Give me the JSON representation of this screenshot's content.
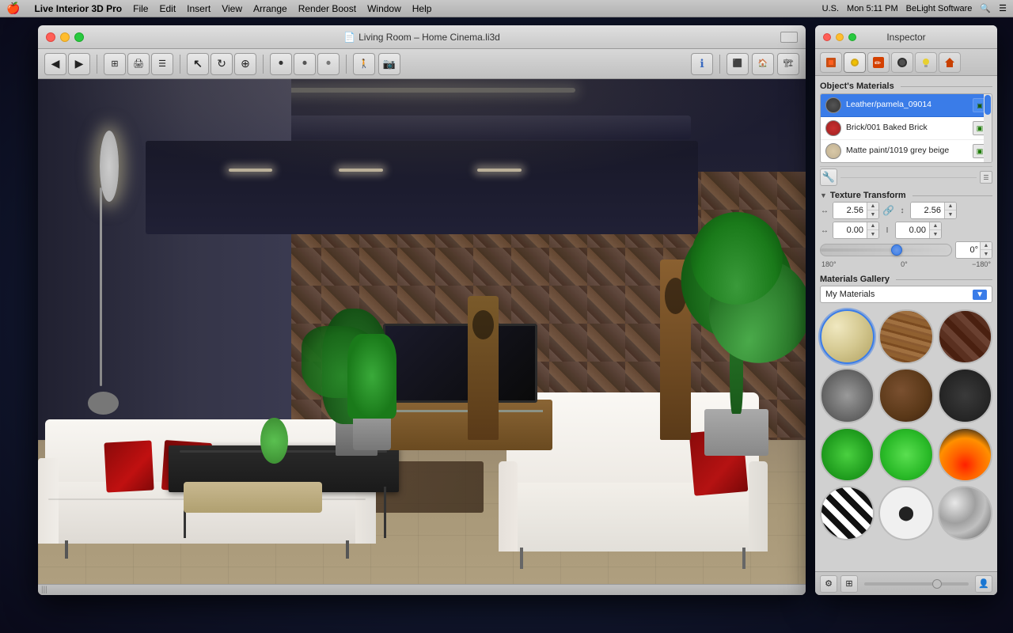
{
  "menubar": {
    "apple": "🍎",
    "app_name": "Live Interior 3D Pro",
    "menus": [
      "File",
      "Edit",
      "Insert",
      "View",
      "Arrange",
      "Render Boost",
      "Window",
      "Help"
    ],
    "right": {
      "time": "Mon 5:11 PM",
      "company": "BeLight Software",
      "battery": "U.S.",
      "search_icon": "🔍"
    }
  },
  "main_window": {
    "title": "Living Room – Home Cinema.li3d",
    "title_icon": "📄"
  },
  "inspector": {
    "title": "Inspector",
    "tabs": [
      {
        "id": "materials-tab",
        "icon": "🟧",
        "active": false
      },
      {
        "id": "light-tab",
        "icon": "⚪",
        "active": true
      },
      {
        "id": "paint-tab",
        "icon": "✏️",
        "active": false
      },
      {
        "id": "texture-tab",
        "icon": "⬛",
        "active": false
      },
      {
        "id": "bulb-tab",
        "icon": "💡",
        "active": false
      },
      {
        "id": "house-tab",
        "icon": "🏠",
        "active": false
      }
    ],
    "objects_materials_label": "Object's Materials",
    "materials": [
      {
        "id": "mat-leather",
        "name": "Leather/pamela_09014",
        "color": "#4a4a4a",
        "selected": true,
        "has_icon": true
      },
      {
        "id": "mat-brick",
        "name": "Brick/001 Baked Brick",
        "color": "#c03030",
        "selected": false,
        "has_icon": true
      },
      {
        "id": "mat-paint",
        "name": "Matte paint/1019 grey beige",
        "color": "#d4c8a8",
        "selected": false,
        "has_icon": true
      }
    ],
    "texture_transform": {
      "label": "Texture Transform",
      "width_value": "2.56",
      "height_value": "2.56",
      "offset_x": "0.00",
      "offset_y": "0.00",
      "rotation_value": "0°",
      "rotation_min": "180°",
      "rotation_center": "0°",
      "rotation_max": "−180°"
    },
    "gallery": {
      "label": "Materials Gallery",
      "dropdown_value": "My Materials",
      "items": [
        {
          "id": "g-fabric",
          "type": "fabric",
          "selected": true
        },
        {
          "id": "g-wood1",
          "type": "wood1",
          "selected": false
        },
        {
          "id": "g-brick",
          "type": "brick",
          "selected": false
        },
        {
          "id": "g-concrete",
          "type": "concrete",
          "selected": false
        },
        {
          "id": "g-leather",
          "type": "leather",
          "selected": false
        },
        {
          "id": "g-dark",
          "type": "dark",
          "selected": false
        },
        {
          "id": "g-green1",
          "type": "green",
          "selected": false
        },
        {
          "id": "g-green2",
          "type": "green2",
          "selected": false
        },
        {
          "id": "g-fire",
          "type": "fire",
          "selected": false
        },
        {
          "id": "g-zebra",
          "type": "zebra",
          "selected": false
        },
        {
          "id": "g-spot",
          "type": "spot",
          "selected": false
        },
        {
          "id": "g-chrome",
          "type": "chrome",
          "selected": false
        }
      ]
    }
  },
  "toolbar": {
    "nav_back": "◀",
    "nav_forward": "▶",
    "floor_plan": "⊞",
    "render": "🖨",
    "view3d": "☰",
    "cursor": "↖",
    "rotate": "↻",
    "move": "⊕",
    "record": "⏺",
    "record2": "⏺",
    "record3": "⏺",
    "person": "🚶",
    "camera": "📷",
    "info": "ℹ",
    "layout1": "⬛",
    "layout2": "🏠",
    "layout3": "🏗"
  },
  "bottom_bar": {
    "scroll_icon": "|||"
  }
}
